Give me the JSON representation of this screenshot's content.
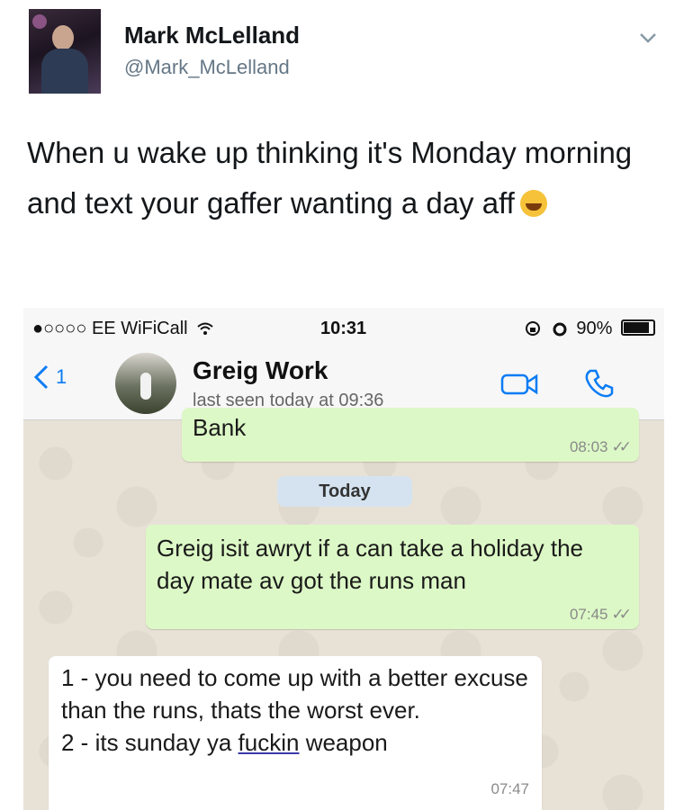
{
  "tweet": {
    "author_name": "Mark McLelland",
    "author_handle": "@Mark_McLelland",
    "text": "When u wake up thinking it's Monday morning and text your gaffer wanting a day aff"
  },
  "phone": {
    "status": {
      "carrier": "●○○○○ EE WiFiCall",
      "time": "10:31",
      "battery": "90%"
    },
    "chat_header": {
      "back_count": "1",
      "contact_name": "Greig Work",
      "last_seen": "last seen today at 09:36"
    },
    "messages": {
      "m0_text": "Bank",
      "m0_time": "08:03",
      "date_label": "Today",
      "m1_text": "Greig isit awryt if a can take a holiday the day mate av got the runs man",
      "m1_time": "07:45",
      "m2_line1": "1 - you need to come up with a better excuse than the runs, thats the worst ever.",
      "m2_line2_prefix": "2 - its sunday ya ",
      "m2_line2_word": "fuckin",
      "m2_line2_suffix": " weapon",
      "m2_time": "07:47"
    }
  }
}
